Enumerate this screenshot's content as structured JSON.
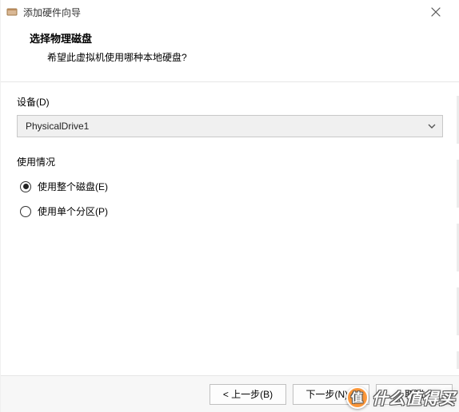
{
  "titlebar": {
    "title": "添加硬件向导"
  },
  "header": {
    "title": "选择物理磁盘",
    "subtitle": "希望此虚拟机使用哪种本地硬盘?"
  },
  "device": {
    "label": "设备(D)",
    "selected": "PhysicalDrive1"
  },
  "usage": {
    "label": "使用情况",
    "options": [
      {
        "label": "使用整个磁盘(E)",
        "checked": true
      },
      {
        "label": "使用单个分区(P)",
        "checked": false
      }
    ]
  },
  "footer": {
    "back": "< 上一步(B)",
    "next": "下一步(N) >",
    "cancel": "取消"
  },
  "watermark": {
    "bubble": "值",
    "text": "什么值得买"
  }
}
